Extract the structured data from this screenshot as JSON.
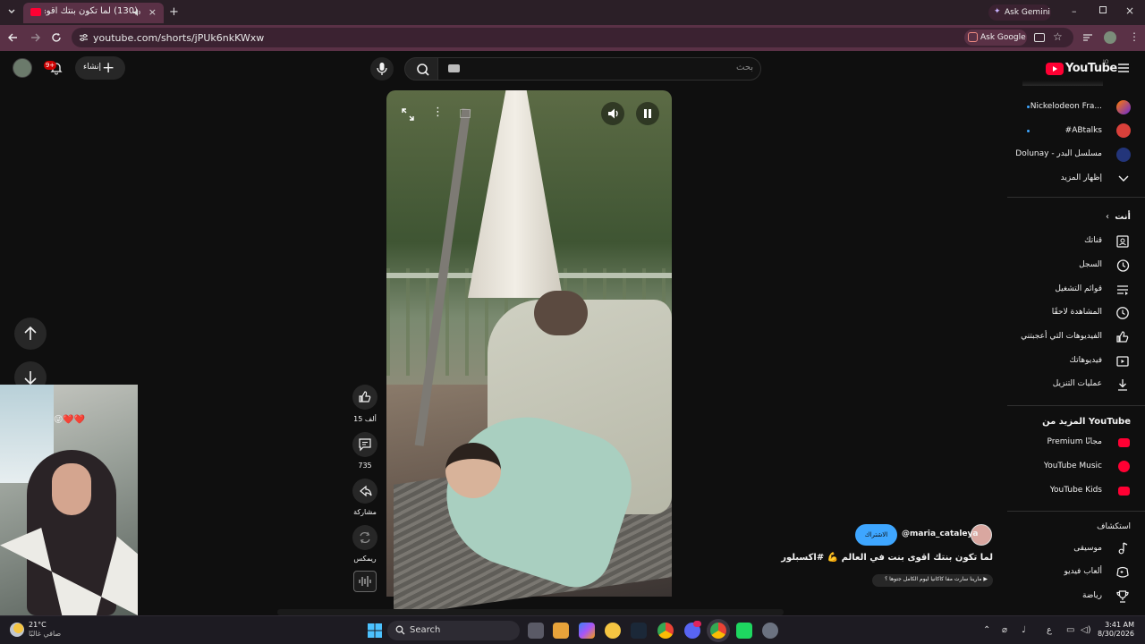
{
  "browser": {
    "tab_title": "(130) لما تكون بنتك اقوى بنت...",
    "tab_close": "×",
    "new_tab": "+",
    "url": "youtube.com/shorts/jPUk6nkKWxw",
    "ask_gemini": "Ask Gemini",
    "ask_google": "Ask Google"
  },
  "header": {
    "search_placeholder": "بحث",
    "create_label": "إنشاء",
    "notifications_count": "9+",
    "logo_text": "YouTube",
    "logo_country": "JO"
  },
  "sidebar": {
    "subscriptions": [
      {
        "label": "Nickelodeon Fra...",
        "has_dot": true
      },
      {
        "label": "#ABtalks",
        "has_dot": true
      },
      {
        "label": "Dolunay - مسلسل البدر",
        "has_dot": false
      }
    ],
    "show_more": "إظهار المزيد",
    "you_header": "أنت",
    "you_items": [
      {
        "label": "قناتك",
        "icon": "channel-icon"
      },
      {
        "label": "السجل",
        "icon": "history-icon"
      },
      {
        "label": "قوائم التشغيل",
        "icon": "playlists-icon"
      },
      {
        "label": "المشاهدة لاحقًا",
        "icon": "watch-later-icon"
      },
      {
        "label": "الفيديوهات التي أعجبتني",
        "icon": "liked-icon"
      },
      {
        "label": "فيديوهاتك",
        "icon": "your-videos-icon"
      },
      {
        "label": "عمليات التنزيل",
        "icon": "downloads-icon"
      }
    ],
    "more_from_youtube": "المزيد من YouTube",
    "more_items": [
      {
        "label": "Premium مجانًا",
        "icon": "premium-icon"
      },
      {
        "label": "YouTube Music",
        "icon": "music-icon"
      },
      {
        "label": "YouTube Kids",
        "icon": "kids-icon"
      }
    ],
    "explore_header": "استكشاف",
    "explore_items": [
      {
        "label": "موسيقى",
        "icon": "music-note-icon"
      },
      {
        "label": "ألعاب فيديو",
        "icon": "gaming-icon"
      },
      {
        "label": "رياضة",
        "icon": "trophy-icon"
      }
    ]
  },
  "short": {
    "likes": "15 ألف",
    "comments": "735",
    "share": "مشاركة",
    "remix": "ريمكس",
    "channel_handle": "@maria_cataleya",
    "subscribe": "الاشتراك",
    "title": "لما تكون بنتك اقوى بنت في العالم 💪 #اكسبلور",
    "sound": "▶ مارينا سارت مفا كاكانيا ليوم الكامل جتوها ؟"
  },
  "webcam": {
    "sticker": "😜❤️❤️"
  },
  "taskbar": {
    "search_label": "Search",
    "temperature": "21°C",
    "weather_desc": "صافي غالبًا",
    "time": "3:41 AM",
    "date": "8/30/2026",
    "lang": "ع"
  },
  "colors": {
    "tab_bar": "#2b1f27",
    "address_bar": "#5a3146",
    "yt_red": "#ff0033",
    "subscribe_blue": "#3ea6ff"
  }
}
